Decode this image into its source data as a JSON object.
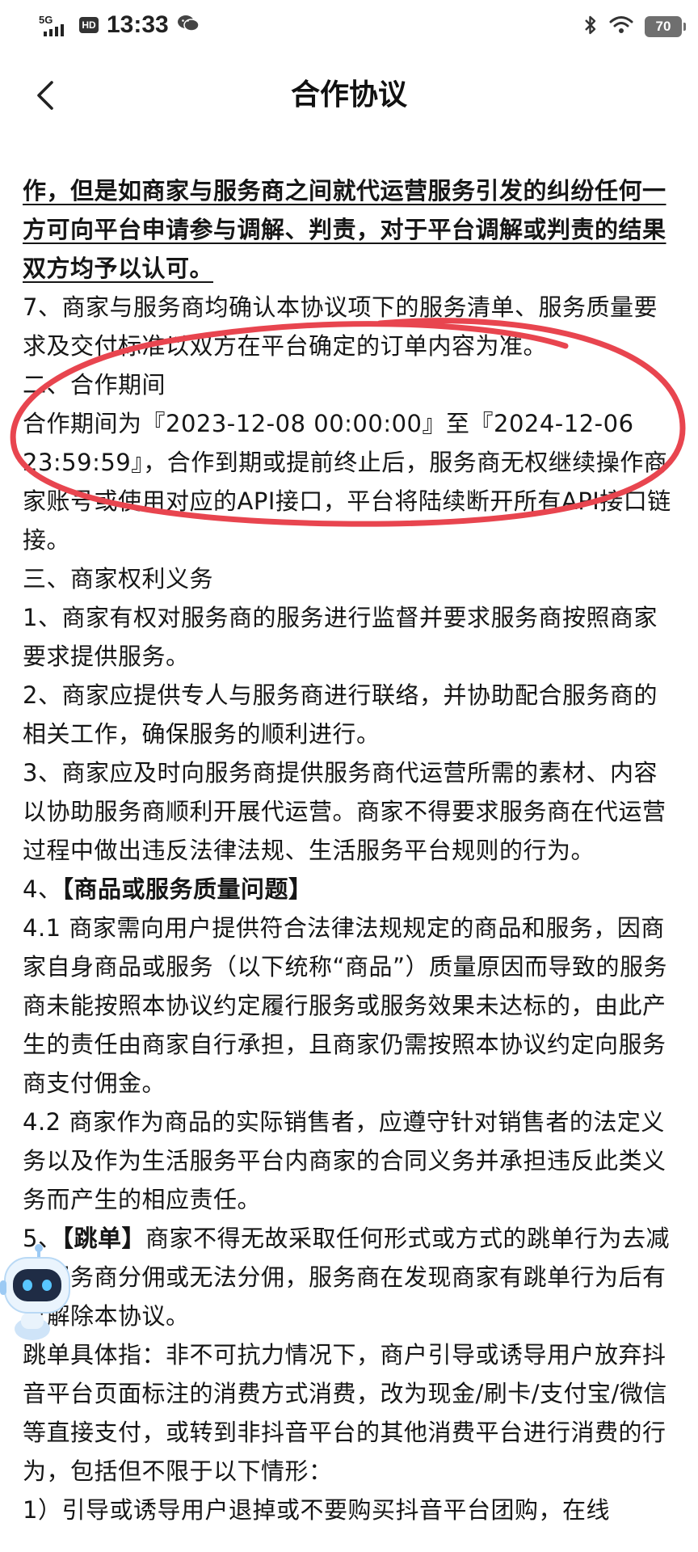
{
  "status_bar": {
    "network": "5G",
    "hd": "HD",
    "time": "13:33",
    "battery": "70",
    "icons": [
      "signal-icon",
      "wechat-icon",
      "bluetooth-icon",
      "wifi-icon",
      "battery-icon"
    ]
  },
  "nav": {
    "title": "合作协议",
    "back_icon": "chevron-left-icon"
  },
  "content": {
    "lead_bold": "作，但是如商家与服务商之间就代运营服务引发的纠纷任何一方可向平台申请参与调解、判责，对于平台调解或判责的结果双方均予以认可。",
    "p7": "7、商家与服务商均确认本协议项下的服务清单、服务质量要求及交付标准以双方在平台确定的订单内容为准。",
    "h2": "二、合作期间",
    "period": "合作期间为『2023-12-08 00:00:00』至『2024-12-06 23:59:59』，合作到期或提前终止后，服务商无权继续操作商家账号或使用对应的API接口，平台将陆续断开所有API接口链接。",
    "h3": "三、商家权利义务",
    "r1": "1、商家有权对服务商的服务进行监督并要求服务商按照商家要求提供服务。",
    "r2": "2、商家应提供专人与服务商进行联络，并协助配合服务商的相关工作，确保服务的顺利进行。",
    "r3": "3、商家应及时向服务商提供服务商代运营所需的素材、内容以协助服务商顺利开展代运营。商家不得要求服务商在代运营过程中做出违反法律法规、生活服务平台规则的行为。",
    "r4_prefix": "4、",
    "r4_bold": "【商品或服务质量问题】",
    "r41": "4.1 商家需向用户提供符合法律法规规定的商品和服务，因商家自身商品或服务（以下统称“商品”）质量原因而导致的服务商未能按照本协议约定履行服务或服务效果未达标的，由此产生的责任由商家自行承担，且商家仍需按照本协议约定向服务商支付佣金。",
    "r42": "4.2 商家作为商品的实际销售者，应遵守针对销售者的法定义务以及作为生活服务平台内商家的合同义务并承担违反此类义务而产生的相应责任。",
    "r5_prefix": "5、",
    "r5_bold": "【跳单】",
    "r5_text": "商家不得无故采取任何形式或方式的跳单行为去减少服务商分佣或无法分佣，服务商在发现商家有跳单行为后有权解除本协议。",
    "r5_detail": "跳单具体指：非不可抗力情况下，商户引导或诱导用户放弃抖音平台页面标注的消费方式消费，改为现金/刷卡/支付宝/微信等直接支付，或转到非抖音平台的其他消费平台进行消费的行为，包括但不限于以下情形：",
    "r5_item1": "1）引导或诱导用户退掉或不要购买抖音平台团购，在线"
  },
  "colors": {
    "annotation_red": "#e8454f",
    "text": "#161616"
  }
}
